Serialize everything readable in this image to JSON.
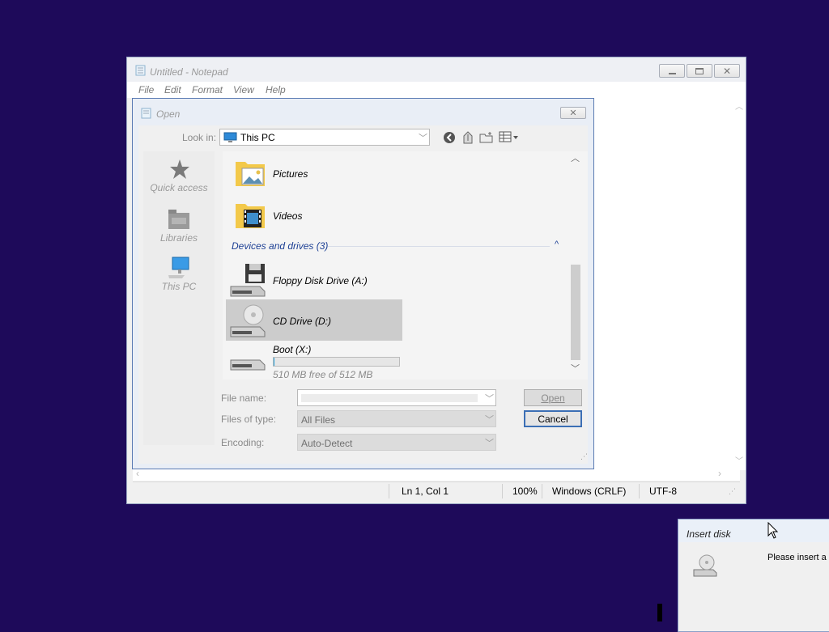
{
  "notepad": {
    "title": "Untitled - Notepad",
    "menu": [
      "File",
      "Edit",
      "Format",
      "View",
      "Help"
    ],
    "status": {
      "position": "Ln 1, Col 1",
      "zoom": "100%",
      "line_ending": "Windows (CRLF)",
      "encoding": "UTF-8"
    }
  },
  "open_dialog": {
    "title": "Open",
    "look_in_label": "Look in:",
    "look_in_value": "This PC",
    "places": [
      "Quick access",
      "Libraries",
      "This PC"
    ],
    "files": [
      {
        "name": "Pictures",
        "icon": "pictures-folder-icon"
      },
      {
        "name": "Videos",
        "icon": "videos-folder-icon"
      }
    ],
    "group_header": "Devices and drives (3)",
    "drives": [
      {
        "name": "Floppy Disk Drive (A:)",
        "icon": "floppy-drive-icon",
        "selected": false
      },
      {
        "name": "CD Drive (D:)",
        "icon": "cd-drive-icon",
        "selected": true
      },
      {
        "name": "Boot (X:)",
        "icon": "hard-drive-icon",
        "free_text": "510 MB free of 512 MB",
        "used_fraction": 0.004
      }
    ],
    "file_name_label": "File name:",
    "file_name_value": "",
    "files_of_type_label": "Files of type:",
    "files_of_type_value": "All Files",
    "encoding_label": "Encoding:",
    "encoding_value": "Auto-Detect",
    "open_button": "Open",
    "cancel_button": "Cancel"
  },
  "insert_disk": {
    "title": "Insert disk",
    "message": "Please insert a d"
  },
  "colors": {
    "desktop": "#1e0a5a",
    "selection": "#cccccc",
    "accent": "#3c6fb5"
  }
}
